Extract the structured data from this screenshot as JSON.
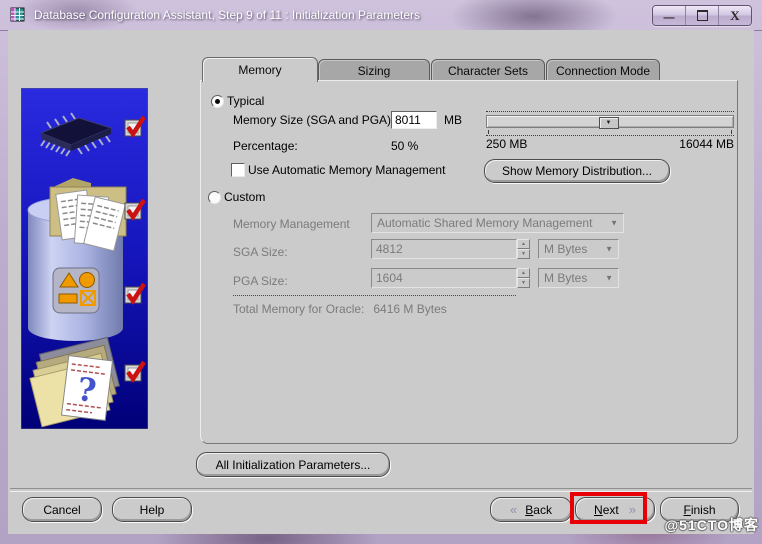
{
  "window": {
    "title": "Database Configuration Assistant, Step 9 of 11 : Initialization Parameters",
    "controls": {
      "minimize_glyph": "—",
      "close_glyph": "X"
    }
  },
  "tabs": {
    "items": [
      {
        "label": "Memory",
        "active": true
      },
      {
        "label": "Sizing",
        "active": false
      },
      {
        "label": "Character Sets",
        "active": false
      },
      {
        "label": "Connection Mode",
        "active": false
      }
    ]
  },
  "memory": {
    "typical": {
      "label": "Typical",
      "selected": true,
      "memory_size_label": "Memory Size (SGA and PGA):",
      "memory_size_value": "8011",
      "memory_size_unit": "MB",
      "percentage_label": "Percentage:",
      "percentage_value": "50 %",
      "slider": {
        "min_label": "250 MB",
        "max_label": "16044 MB",
        "thumb_glyph": "▼",
        "percent": 49
      },
      "amm_checkbox_label": "Use Automatic Memory Management",
      "amm_checked": false,
      "show_distribution_label": "Show Memory Distribution..."
    },
    "custom": {
      "label": "Custom",
      "selected": false,
      "memory_management_label": "Memory Management",
      "memory_management_value": "Automatic Shared Memory Management",
      "sga_label": "SGA Size:",
      "sga_value": "4812",
      "pga_label": "PGA Size:",
      "pga_value": "1604",
      "unit_value": "M Bytes",
      "total_label": "Total Memory for Oracle:",
      "total_value": "6416 M Bytes"
    },
    "all_params_label": "All Initialization Parameters..."
  },
  "footer": {
    "cancel_label": "Cancel",
    "help_label": "Help",
    "back": {
      "chevron": "«",
      "mnemonic": "B",
      "rest": "ack"
    },
    "next": {
      "mnemonic": "N",
      "rest": "ext",
      "chevron": "»"
    },
    "finish": {
      "mnemonic": "F",
      "rest": "inish"
    }
  },
  "glyphs": {
    "dropdown_arrow": "▼",
    "spinner_up": "▲",
    "spinner_down": "▼"
  },
  "watermark": "@51CTO博客",
  "colors": {
    "annotation_red": "#e70008",
    "panel_gray": "#cbcbcb",
    "frame_purple": "#bdadcd",
    "sidebar_blue": "#1515bb"
  }
}
